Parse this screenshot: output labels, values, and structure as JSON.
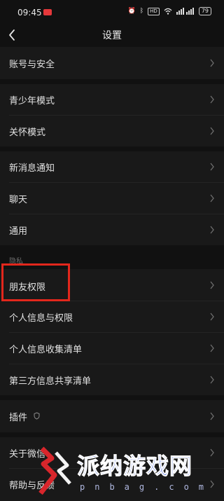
{
  "status_bar": {
    "time": "09:45",
    "hd_badge": "HD",
    "battery": "79",
    "icons": [
      "alarm-icon",
      "bluetooth-icon",
      "wifi-icon",
      "signal-icon"
    ]
  },
  "nav": {
    "title": "设置"
  },
  "groups": {
    "account": {
      "items": [
        {
          "label": "账号与安全"
        }
      ]
    },
    "modes": {
      "items": [
        {
          "label": "青少年模式"
        },
        {
          "label": "关怀模式"
        }
      ]
    },
    "general": {
      "items": [
        {
          "label": "新消息通知"
        },
        {
          "label": "聊天"
        },
        {
          "label": "通用"
        }
      ]
    },
    "privacy": {
      "header": "隐私",
      "items": [
        {
          "label": "朋友权限"
        },
        {
          "label": "个人信息与权限"
        },
        {
          "label": "个人信息收集清单"
        },
        {
          "label": "第三方信息共享清单"
        }
      ]
    },
    "plugins": {
      "items": [
        {
          "label": "插件"
        }
      ]
    },
    "about": {
      "items": [
        {
          "label": "关于微信"
        },
        {
          "label": "帮助与反馈"
        }
      ]
    }
  },
  "highlight": {
    "color": "#e2271c"
  },
  "watermark": {
    "text": "派纳游戏网",
    "sub": "pnbag.com"
  }
}
